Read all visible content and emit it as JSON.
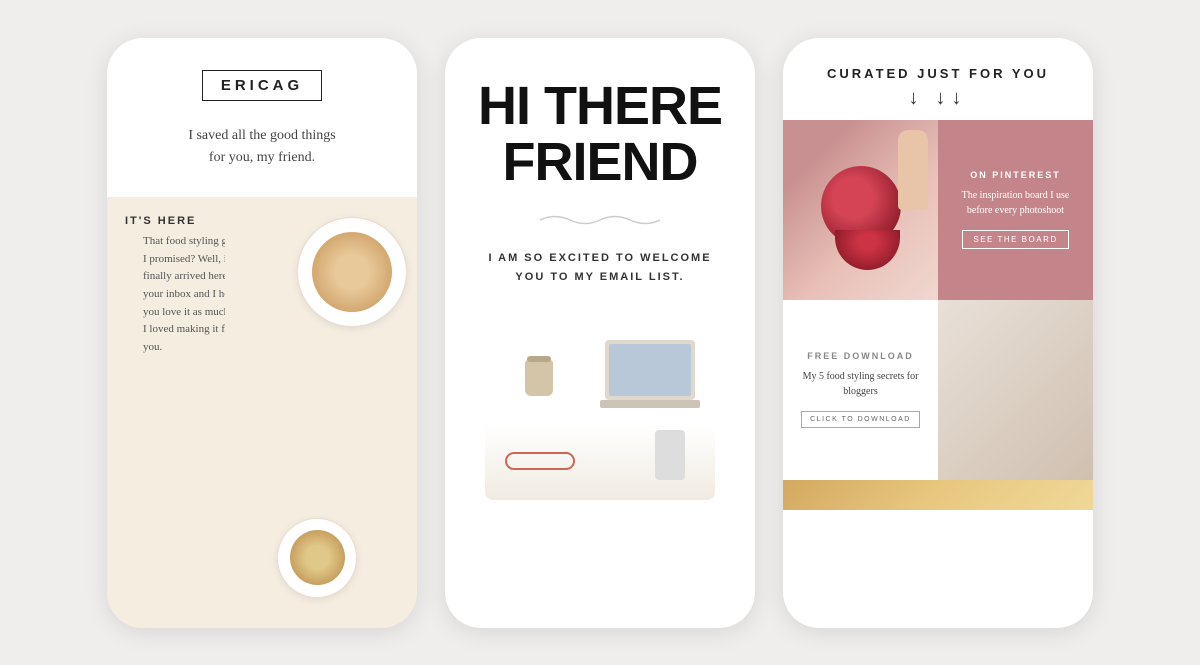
{
  "phone1": {
    "logo": "ERICAG",
    "tagline": "I saved all the good things\nfor you, my friend.",
    "its_here_label": "IT'S HERE",
    "food_text": "That food styling guide I promised? Well, it's finally arrived here in your inbox and I hope you love it as much as I loved making it for you.",
    "food_tag": "food"
  },
  "phone2": {
    "headline_line1": "HI THERE",
    "headline_line2": "FRIEND",
    "welcome_text": "I AM SO EXCITED TO WELCOME\nYOU TO MY EMAIL LIST."
  },
  "phone3": {
    "curated_title": "CURATED JUST FOR YOU",
    "arrows": "↓  ↓↓",
    "pinterest": {
      "label": "ON PINTEREST",
      "description": "The inspiration board I use before every photoshoot",
      "button": "SEE THE BOARD"
    },
    "download": {
      "label": "FREE DOWNLOAD",
      "description": "My 5 food styling secrets for bloggers",
      "button": "CLICK TO DOWNLOAD"
    }
  }
}
